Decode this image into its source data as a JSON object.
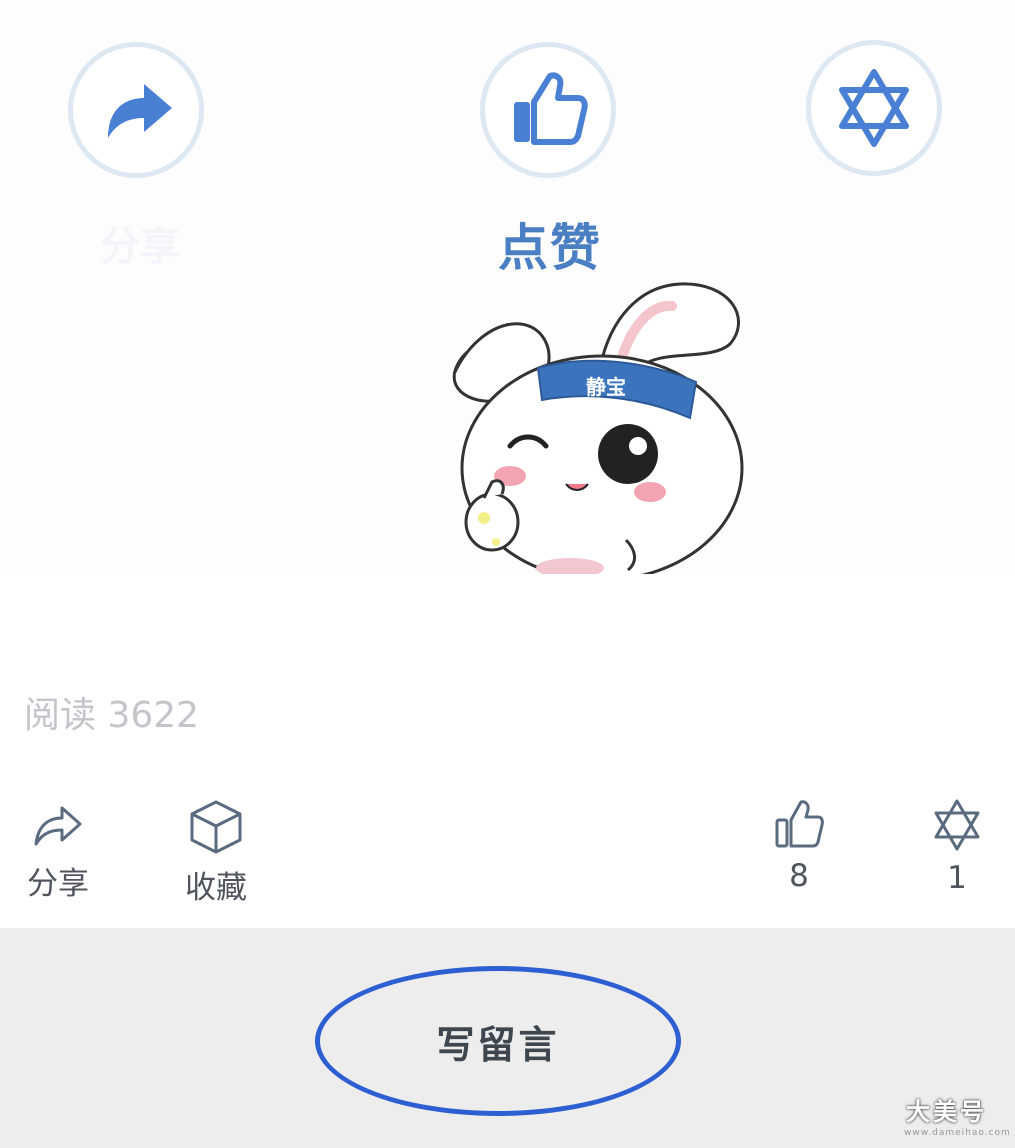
{
  "banner": {
    "title": "点赞",
    "buttons": [
      {
        "icon": "share-arrow-icon"
      },
      {
        "icon": "thumbs-up-icon"
      },
      {
        "icon": "star-of-david-icon"
      }
    ],
    "mascot": {
      "headband_text": "静宝",
      "icon": "bunny-mascot"
    }
  },
  "stats": {
    "read_count": "阅读 3622"
  },
  "actions": {
    "share_label": "分享",
    "favorite_label": "收藏",
    "like_count": "8",
    "wow_count": "1"
  },
  "footer": {
    "comment_button": "写留言"
  },
  "watermark": {
    "text": "大美号",
    "sub": "www.dameihao.com"
  },
  "colors": {
    "accent": "#4a7fc4",
    "comment_border": "#2e5fd2",
    "footer_bg": "#ededee"
  }
}
